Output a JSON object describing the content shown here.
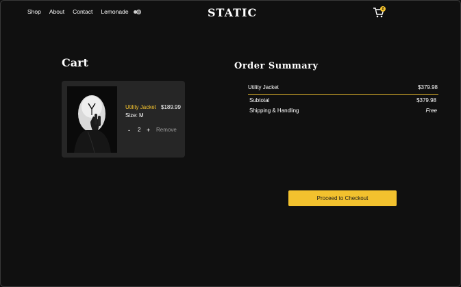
{
  "nav": {
    "links": [
      "Shop",
      "About",
      "Contact",
      "Lemonade"
    ],
    "logo": "STATIC",
    "cart_count": "2"
  },
  "cart": {
    "title": "Cart",
    "item": {
      "name": "Utility Jacket",
      "price": "$189.99",
      "size": "Size: M",
      "quantity": "2",
      "minus": "-",
      "plus": "+",
      "remove": "Remove"
    }
  },
  "summary": {
    "title": "Order Summary",
    "line_item": {
      "name": "Utility Jacket",
      "amount": "$379.98"
    },
    "subtotal": {
      "label": "Subtotal",
      "value": "$379.98"
    },
    "shipping": {
      "label": "Shipping & Handling",
      "value": "Free"
    },
    "checkout_label": "Proceed to Checkout"
  },
  "colors": {
    "accent": "#f2c12e",
    "background": "#101010",
    "card": "#262626"
  }
}
